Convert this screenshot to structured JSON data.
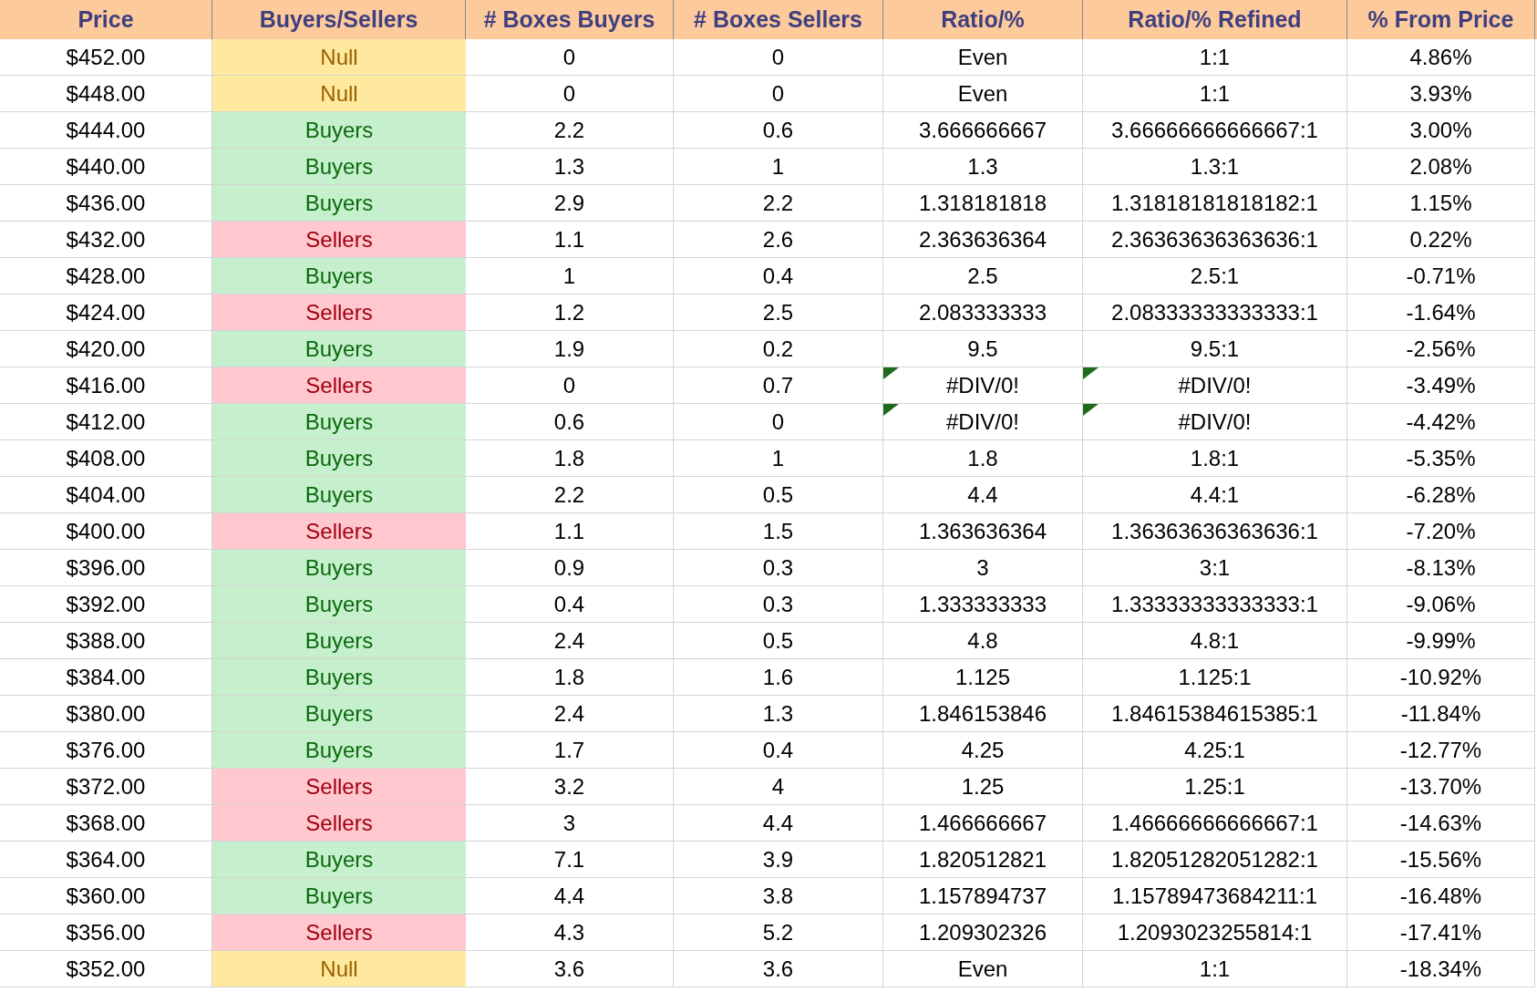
{
  "table": {
    "columns": [
      "Price",
      "Buyers/Sellers",
      "# Boxes Buyers",
      "# Boxes Sellers",
      "Ratio/%",
      "Ratio/% Refined",
      "% From Price"
    ],
    "rows": [
      {
        "price": "$452.00",
        "side": {
          "kind": "null",
          "label": "Null"
        },
        "buyers": "0",
        "sellers": "0",
        "ratio": "Even",
        "refined": "1:1",
        "pct": "4.86%",
        "error_flag": false
      },
      {
        "price": "$448.00",
        "side": {
          "kind": "null",
          "label": "Null"
        },
        "buyers": "0",
        "sellers": "0",
        "ratio": "Even",
        "refined": "1:1",
        "pct": "3.93%",
        "error_flag": false
      },
      {
        "price": "$444.00",
        "side": {
          "kind": "buyers",
          "label": "Buyers"
        },
        "buyers": "2.2",
        "sellers": "0.6",
        "ratio": "3.666666667",
        "refined": "3.66666666666667:1",
        "pct": "3.00%",
        "error_flag": false
      },
      {
        "price": "$440.00",
        "side": {
          "kind": "buyers",
          "label": "Buyers"
        },
        "buyers": "1.3",
        "sellers": "1",
        "ratio": "1.3",
        "refined": "1.3:1",
        "pct": "2.08%",
        "error_flag": false
      },
      {
        "price": "$436.00",
        "side": {
          "kind": "buyers",
          "label": "Buyers"
        },
        "buyers": "2.9",
        "sellers": "2.2",
        "ratio": "1.318181818",
        "refined": "1.31818181818182:1",
        "pct": "1.15%",
        "error_flag": false
      },
      {
        "price": "$432.00",
        "side": {
          "kind": "sellers",
          "label": "Sellers"
        },
        "buyers": "1.1",
        "sellers": "2.6",
        "ratio": "2.363636364",
        "refined": "2.36363636363636:1",
        "pct": "0.22%",
        "error_flag": false
      },
      {
        "price": "$428.00",
        "side": {
          "kind": "buyers",
          "label": "Buyers"
        },
        "buyers": "1",
        "sellers": "0.4",
        "ratio": "2.5",
        "refined": "2.5:1",
        "pct": "-0.71%",
        "error_flag": false
      },
      {
        "price": "$424.00",
        "side": {
          "kind": "sellers",
          "label": "Sellers"
        },
        "buyers": "1.2",
        "sellers": "2.5",
        "ratio": "2.083333333",
        "refined": "2.08333333333333:1",
        "pct": "-1.64%",
        "error_flag": false
      },
      {
        "price": "$420.00",
        "side": {
          "kind": "buyers",
          "label": "Buyers"
        },
        "buyers": "1.9",
        "sellers": "0.2",
        "ratio": "9.5",
        "refined": "9.5:1",
        "pct": "-2.56%",
        "error_flag": false
      },
      {
        "price": "$416.00",
        "side": {
          "kind": "sellers",
          "label": "Sellers"
        },
        "buyers": "0",
        "sellers": "0.7",
        "ratio": "#DIV/0!",
        "refined": "#DIV/0!",
        "pct": "-3.49%",
        "error_flag": true
      },
      {
        "price": "$412.00",
        "side": {
          "kind": "buyers",
          "label": "Buyers"
        },
        "buyers": "0.6",
        "sellers": "0",
        "ratio": "#DIV/0!",
        "refined": "#DIV/0!",
        "pct": "-4.42%",
        "error_flag": true
      },
      {
        "price": "$408.00",
        "side": {
          "kind": "buyers",
          "label": "Buyers"
        },
        "buyers": "1.8",
        "sellers": "1",
        "ratio": "1.8",
        "refined": "1.8:1",
        "pct": "-5.35%",
        "error_flag": false
      },
      {
        "price": "$404.00",
        "side": {
          "kind": "buyers",
          "label": "Buyers"
        },
        "buyers": "2.2",
        "sellers": "0.5",
        "ratio": "4.4",
        "refined": "4.4:1",
        "pct": "-6.28%",
        "error_flag": false
      },
      {
        "price": "$400.00",
        "side": {
          "kind": "sellers",
          "label": "Sellers"
        },
        "buyers": "1.1",
        "sellers": "1.5",
        "ratio": "1.363636364",
        "refined": "1.36363636363636:1",
        "pct": "-7.20%",
        "error_flag": false
      },
      {
        "price": "$396.00",
        "side": {
          "kind": "buyers",
          "label": "Buyers"
        },
        "buyers": "0.9",
        "sellers": "0.3",
        "ratio": "3",
        "refined": "3:1",
        "pct": "-8.13%",
        "error_flag": false
      },
      {
        "price": "$392.00",
        "side": {
          "kind": "buyers",
          "label": "Buyers"
        },
        "buyers": "0.4",
        "sellers": "0.3",
        "ratio": "1.333333333",
        "refined": "1.33333333333333:1",
        "pct": "-9.06%",
        "error_flag": false
      },
      {
        "price": "$388.00",
        "side": {
          "kind": "buyers",
          "label": "Buyers"
        },
        "buyers": "2.4",
        "sellers": "0.5",
        "ratio": "4.8",
        "refined": "4.8:1",
        "pct": "-9.99%",
        "error_flag": false
      },
      {
        "price": "$384.00",
        "side": {
          "kind": "buyers",
          "label": "Buyers"
        },
        "buyers": "1.8",
        "sellers": "1.6",
        "ratio": "1.125",
        "refined": "1.125:1",
        "pct": "-10.92%",
        "error_flag": false
      },
      {
        "price": "$380.00",
        "side": {
          "kind": "buyers",
          "label": "Buyers"
        },
        "buyers": "2.4",
        "sellers": "1.3",
        "ratio": "1.846153846",
        "refined": "1.84615384615385:1",
        "pct": "-11.84%",
        "error_flag": false
      },
      {
        "price": "$376.00",
        "side": {
          "kind": "buyers",
          "label": "Buyers"
        },
        "buyers": "1.7",
        "sellers": "0.4",
        "ratio": "4.25",
        "refined": "4.25:1",
        "pct": "-12.77%",
        "error_flag": false
      },
      {
        "price": "$372.00",
        "side": {
          "kind": "sellers",
          "label": "Sellers"
        },
        "buyers": "3.2",
        "sellers": "4",
        "ratio": "1.25",
        "refined": "1.25:1",
        "pct": "-13.70%",
        "error_flag": false
      },
      {
        "price": "$368.00",
        "side": {
          "kind": "sellers",
          "label": "Sellers"
        },
        "buyers": "3",
        "sellers": "4.4",
        "ratio": "1.466666667",
        "refined": "1.46666666666667:1",
        "pct": "-14.63%",
        "error_flag": false
      },
      {
        "price": "$364.00",
        "side": {
          "kind": "buyers",
          "label": "Buyers"
        },
        "buyers": "7.1",
        "sellers": "3.9",
        "ratio": "1.820512821",
        "refined": "1.82051282051282:1",
        "pct": "-15.56%",
        "error_flag": false
      },
      {
        "price": "$360.00",
        "side": {
          "kind": "buyers",
          "label": "Buyers"
        },
        "buyers": "4.4",
        "sellers": "3.8",
        "ratio": "1.157894737",
        "refined": "1.15789473684211:1",
        "pct": "-16.48%",
        "error_flag": false
      },
      {
        "price": "$356.00",
        "side": {
          "kind": "sellers",
          "label": "Sellers"
        },
        "buyers": "4.3",
        "sellers": "5.2",
        "ratio": "1.209302326",
        "refined": "1.2093023255814:1",
        "pct": "-17.41%",
        "error_flag": false
      },
      {
        "price": "$352.00",
        "side": {
          "kind": "null",
          "label": "Null"
        },
        "buyers": "3.6",
        "sellers": "3.6",
        "ratio": "Even",
        "refined": "1:1",
        "pct": "-18.34%",
        "error_flag": false
      }
    ]
  }
}
